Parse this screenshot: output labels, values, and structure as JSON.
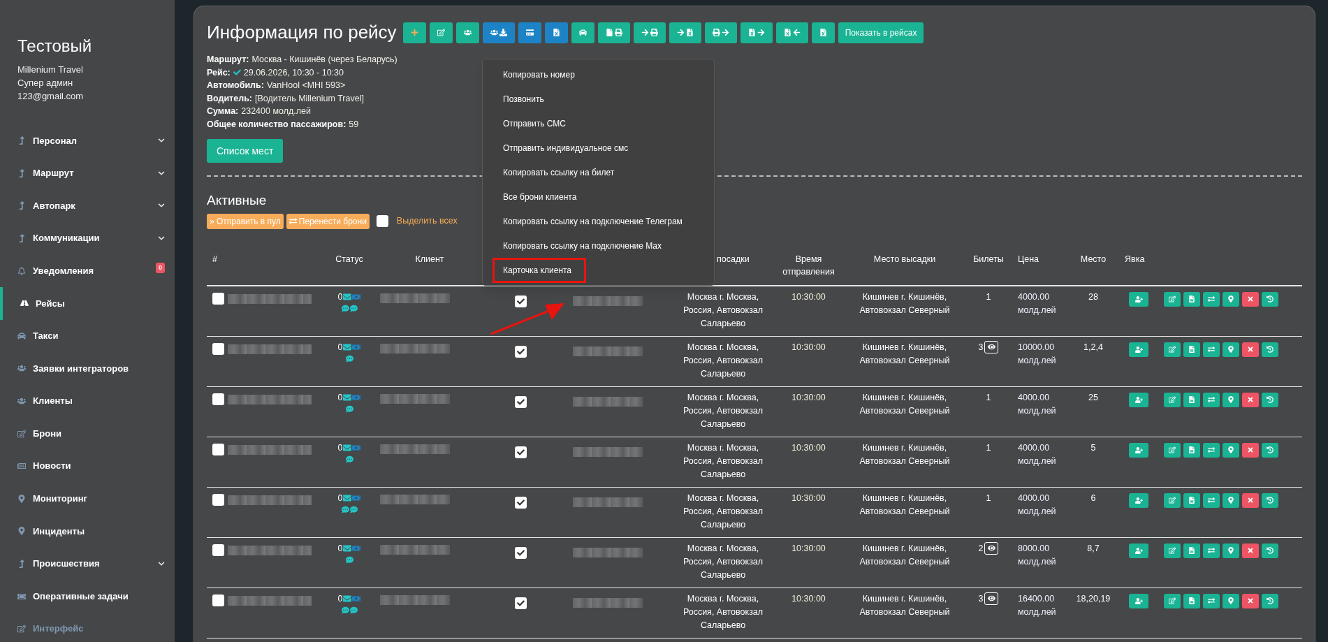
{
  "sidebar": {
    "title": "Тестовый",
    "company": "Millenium Travel",
    "role": "Супер админ",
    "email": "123@gmail.com",
    "items": [
      {
        "label": "Персонал",
        "expandable": true,
        "selected": false,
        "dimmed": false
      },
      {
        "label": "Маршрут",
        "expandable": true,
        "selected": false,
        "dimmed": false
      },
      {
        "label": "Автопарк",
        "expandable": true,
        "selected": false,
        "dimmed": false
      },
      {
        "label": "Коммуникации",
        "expandable": true,
        "selected": false,
        "dimmed": false
      },
      {
        "label": "Уведомления",
        "expandable": false,
        "selected": false,
        "dimmed": false,
        "badge": "0"
      },
      {
        "label": "Рейсы",
        "expandable": false,
        "selected": true,
        "dimmed": false
      },
      {
        "label": "Такси",
        "expandable": false,
        "selected": false,
        "dimmed": false
      },
      {
        "label": "Заявки интеграторов",
        "expandable": false,
        "selected": false,
        "dimmed": false
      },
      {
        "label": "Клиенты",
        "expandable": false,
        "selected": false,
        "dimmed": false
      },
      {
        "label": "Брони",
        "expandable": false,
        "selected": false,
        "dimmed": false
      },
      {
        "label": "Новости",
        "expandable": false,
        "selected": false,
        "dimmed": false
      },
      {
        "label": "Мониторинг",
        "expandable": false,
        "selected": false,
        "dimmed": false
      },
      {
        "label": "Инциденты",
        "expandable": false,
        "selected": false,
        "dimmed": false
      },
      {
        "label": "Происшествия",
        "expandable": true,
        "selected": false,
        "dimmed": false
      },
      {
        "label": "Оперативные задачи",
        "expandable": false,
        "selected": false,
        "dimmed": false
      },
      {
        "label": "Интерфейс",
        "expandable": false,
        "selected": false,
        "dimmed": true
      }
    ]
  },
  "header": {
    "title": "Информация по рейсу",
    "toolbar": [
      {
        "kind": "success"
      },
      {
        "kind": "success"
      },
      {
        "kind": "success"
      },
      {
        "kind": "info"
      },
      {
        "kind": "info"
      },
      {
        "kind": "info"
      },
      {
        "kind": "success"
      },
      {
        "kind": "success"
      },
      {
        "kind": "success"
      },
      {
        "kind": "success"
      },
      {
        "kind": "success"
      },
      {
        "kind": "success"
      },
      {
        "kind": "success"
      },
      {
        "kind": "success"
      }
    ],
    "show_button": "Показать в рейсах"
  },
  "info": [
    {
      "label": "Маршрут:",
      "value": "Москва - Кишинёв (через Беларусь)"
    },
    {
      "label": "Рейс:",
      "value": "29.06.2026, 10:30 - 10:30",
      "verified": true
    },
    {
      "label": "Автомобиль:",
      "value": "VanHool <МНI 593>"
    },
    {
      "label": "Водитель:",
      "value": "[Водитель Millenium Travel]"
    },
    {
      "label": "Сумма:",
      "value": "232400 молд.лей"
    },
    {
      "label": "Общее количество пассажиров:",
      "value": "59"
    }
  ],
  "seats_button": "Список мест",
  "section": {
    "title": "Активные",
    "pool_button": "» Отправить в пул",
    "transfer_button": "Перенести брони",
    "select_all": {
      "label": "Выделить всех",
      "checked": false
    }
  },
  "table": {
    "columns": [
      "#",
      "Статус",
      "Клиент",
      "посадки",
      "Время отправления",
      "Место высадки",
      "Билеты",
      "Цена",
      "Место",
      "Явка"
    ],
    "rows": [
      {
        "selected": false,
        "status": "0",
        "chats": [
          {
            "kind": "chat"
          },
          {
            "kind": "chat"
          }
        ],
        "checked": true,
        "boarding": "Москва г. Москва, Россия, Автовокзал Саларьево",
        "time": "10:30:00",
        "dropoff": "Кишинев г. Кишинёв, Автовокзал Северный",
        "tickets": "1",
        "details": false,
        "price": "4000.00 молд.лей",
        "seat": "28"
      },
      {
        "selected": false,
        "status": "0",
        "chats": [
          {
            "kind": "chat"
          }
        ],
        "checked": true,
        "boarding": "Москва г. Москва, Россия, Автовокзал Саларьево",
        "time": "10:30:00",
        "dropoff": "Кишинев г. Кишинёв, Автовокзал Северный",
        "tickets": "3",
        "details": true,
        "price": "10000.00 молд.лей",
        "seat": "1,2,4"
      },
      {
        "selected": false,
        "status": "0",
        "chats": [
          {
            "kind": "chat"
          }
        ],
        "checked": true,
        "boarding": "Москва г. Москва, Россия, Автовокзал Саларьево",
        "time": "10:30:00",
        "dropoff": "Кишинев г. Кишинёв, Автовокзал Северный",
        "tickets": "1",
        "details": false,
        "price": "4000.00 молд.лей",
        "seat": "25"
      },
      {
        "selected": false,
        "status": "0",
        "chats": [
          {
            "kind": "chat"
          }
        ],
        "checked": true,
        "boarding": "Москва г. Москва, Россия, Автовокзал Саларьево",
        "time": "10:30:00",
        "dropoff": "Кишинев г. Кишинёв, Автовокзал Северный",
        "tickets": "1",
        "details": false,
        "price": "4000.00 молд.лей",
        "seat": "5"
      },
      {
        "selected": false,
        "status": "0",
        "chats": [
          {
            "kind": "chat"
          },
          {
            "kind": "chat"
          }
        ],
        "checked": true,
        "boarding": "Москва г. Москва, Россия, Автовокзал Саларьево",
        "time": "10:30:00",
        "dropoff": "Кишинев г. Кишинёв, Автовокзал Северный",
        "tickets": "1",
        "details": false,
        "price": "4000.00 молд.лей",
        "seat": "6"
      },
      {
        "selected": false,
        "status": "0",
        "chats": [
          {
            "kind": "chat"
          }
        ],
        "checked": true,
        "boarding": "Москва г. Москва, Россия, Автовокзал Саларьево",
        "time": "10:30:00",
        "dropoff": "Кишинев г. Кишинёв, Автовокзал Северный",
        "tickets": "2",
        "details": true,
        "price": "8000.00 молд.лей",
        "seat": "8,7"
      },
      {
        "selected": false,
        "status": "0",
        "chats": [
          {
            "kind": "chat"
          },
          {
            "kind": "chat"
          }
        ],
        "checked": true,
        "boarding": "Москва г. Москва, Россия, Автовокзал Саларьево",
        "time": "10:30:00",
        "dropoff": "Кишинев г. Кишинёв, Автовокзал Северный",
        "tickets": "3",
        "details": true,
        "price": "16400.00 молд.лей",
        "seat": "18,20,19"
      }
    ]
  },
  "context_menu": {
    "items": [
      {
        "label": "Копировать номер",
        "highlighted": false
      },
      {
        "label": "Позвонить",
        "highlighted": false
      },
      {
        "label": "Отправить СМС",
        "highlighted": false
      },
      {
        "label": "Отправить индивидуальное смс",
        "highlighted": false
      },
      {
        "label": "Копировать ссылку на билет",
        "highlighted": false
      },
      {
        "label": "Все брони клиента",
        "highlighted": false
      },
      {
        "label": "Копировать ссылку на подключение Телеграм",
        "highlighted": false
      },
      {
        "label": "Копировать ссылку на подключение Max",
        "highlighted": false
      },
      {
        "label": "Карточка клиента",
        "highlighted": true
      }
    ]
  }
}
